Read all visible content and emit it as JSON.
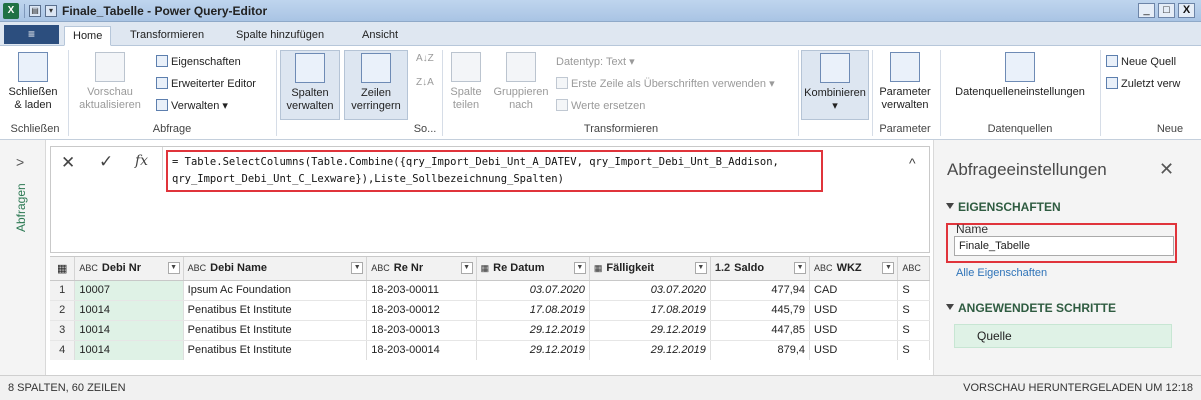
{
  "window": {
    "title": "Finale_Tabelle - Power Query-Editor",
    "app_icon_letter": "X",
    "controls": {
      "minimize": "_",
      "maximize": "□",
      "close": "X"
    }
  },
  "tabs": {
    "file": "≡",
    "items": [
      "Home",
      "Transformieren",
      "Spalte hinzufügen",
      "Ansicht"
    ]
  },
  "ribbon": {
    "schliessen_group": {
      "btn_line1": "Schließen",
      "btn_line2": "& laden",
      "label": "Schließen"
    },
    "abfrage_group": {
      "vorschau_line1": "Vorschau",
      "vorschau_line2": "aktualisieren",
      "eigenschaften": "Eigenschaften",
      "erweiterter_editor": "Erweiterter Editor",
      "verwalten": "Verwalten",
      "label": "Abfrage"
    },
    "so_group": {
      "spalten_line1": "Spalten",
      "spalten_line2": "verwalten",
      "zeilen_line1": "Zeilen",
      "zeilen_line2": "verringern",
      "label": "So..."
    },
    "transformieren_group": {
      "spalte_line1": "Spalte",
      "spalte_line2": "teilen",
      "gruppieren_line1": "Gruppieren",
      "gruppieren_line2": "nach",
      "datentyp": "Datentyp: Text",
      "erste_zeile": "Erste Zeile als Überschriften verwenden",
      "werte_ersetzen": "Werte ersetzen",
      "label": "Transformieren"
    },
    "kombinieren": "Kombinieren",
    "parameter_group": {
      "btn_line1": "Parameter",
      "btn_line2": "verwalten",
      "label": "Parameter"
    },
    "datenquellen_group": {
      "btn": "Datenquelleneinstellungen",
      "label": "Datenquellen"
    },
    "neue_group": {
      "neue_quelle": "Neue Quell",
      "zuletzt": "Zuletzt verw",
      "label": "Neue"
    }
  },
  "left_pane": {
    "label": "Abfragen",
    "collapse": ">"
  },
  "formula_bar": {
    "cancel": "✕",
    "commit": "✓",
    "fx": "fx",
    "line1": "= Table.SelectColumns(Table.Combine({qry_Import_Debi_Unt_A_DATEV, qry_Import_Debi_Unt_B_Addison,",
    "line2": "qry_Import_Debi_Unt_C_Lexware}),Liste_Sollbezeichnung_Spalten)",
    "expand": "^"
  },
  "grid": {
    "columns": [
      {
        "type": "ABC",
        "name": "Debi Nr"
      },
      {
        "type": "ABC",
        "name": "Debi Name"
      },
      {
        "type": "ABC",
        "name": "Re Nr"
      },
      {
        "type": "cal",
        "name": "Re Datum"
      },
      {
        "type": "cal",
        "name": "Fälligkeit"
      },
      {
        "type": "1.2",
        "name": "Saldo"
      },
      {
        "type": "ABC",
        "name": "WKZ"
      },
      {
        "type": "ABC",
        "name": ""
      }
    ],
    "rows": [
      {
        "n": "1",
        "debi_nr": "10007",
        "debi_name": "Ipsum Ac Foundation",
        "re_nr": "18-203-00011",
        "re_datum": "03.07.2020",
        "faelligkeit": "03.07.2020",
        "saldo": "477,94",
        "wkz": "CAD",
        "last": "S"
      },
      {
        "n": "2",
        "debi_nr": "10014",
        "debi_name": "Penatibus Et Institute",
        "re_nr": "18-203-00012",
        "re_datum": "17.08.2019",
        "faelligkeit": "17.08.2019",
        "saldo": "445,79",
        "wkz": "USD",
        "last": "S"
      },
      {
        "n": "3",
        "debi_nr": "10014",
        "debi_name": "Penatibus Et Institute",
        "re_nr": "18-203-00013",
        "re_datum": "29.12.2019",
        "faelligkeit": "29.12.2019",
        "saldo": "447,85",
        "wkz": "USD",
        "last": "S"
      },
      {
        "n": "4",
        "debi_nr": "10014",
        "debi_name": "Penatibus Et Institute",
        "re_nr": "18-203-00014",
        "re_datum": "29.12.2019",
        "faelligkeit": "29.12.2019",
        "saldo": "879,4",
        "wkz": "USD",
        "last": "S"
      }
    ]
  },
  "settings_pane": {
    "title": "Abfrageeinstellungen",
    "close": "✕",
    "eigenschaften": "EIGENSCHAFTEN",
    "name_label": "Name",
    "name_value": "Finale_Tabelle",
    "alle_eigenschaften": "Alle Eigenschaften",
    "angewendete_schritte": "ANGEWENDETE SCHRITTE",
    "steps": [
      "Quelle"
    ]
  },
  "status": {
    "left": "8 SPALTEN, 60 ZEILEN",
    "right": "VORSCHAU HERUNTERGELADEN UM 12:18"
  },
  "colors": {
    "title_bar": "#bfd5ee",
    "highlight_red": "#e0343b",
    "selected_green": "#dff2e6",
    "accent_green": "#2f5c41",
    "link_blue": "#2e73b8"
  }
}
